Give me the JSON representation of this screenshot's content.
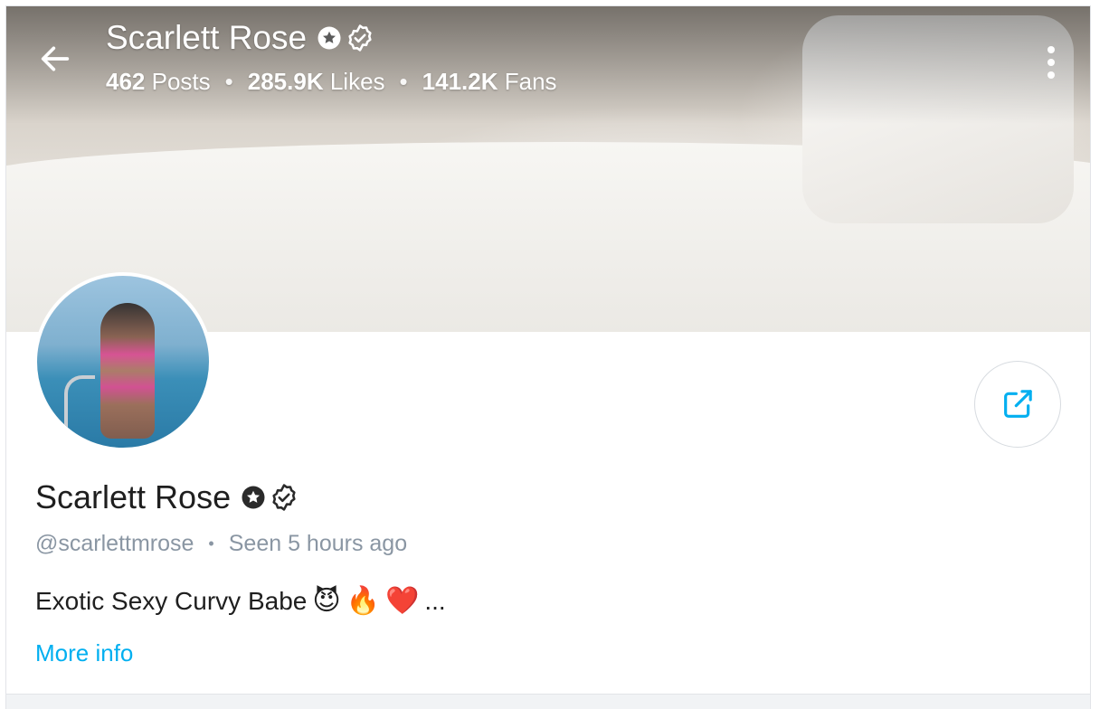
{
  "header": {
    "name": "Scarlett Rose",
    "stats": [
      {
        "value": "462",
        "label": "Posts"
      },
      {
        "value": "285.9K",
        "label": "Likes"
      },
      {
        "value": "141.2K",
        "label": "Fans"
      }
    ],
    "separator": "•",
    "text_color": "#ffffff"
  },
  "icons": {
    "back": "arrow-left-icon",
    "more": "more-vertical-icon",
    "share": "share-icon",
    "star_badge": "star-badge-icon",
    "verified_badge": "verified-check-icon"
  },
  "profile": {
    "name": "Scarlett Rose",
    "handle": "@scarlettmrose",
    "separator": "•",
    "seen": "Seen 5 hours ago",
    "bio_text": "Exotic Sexy Curvy Babe",
    "bio_emojis": [
      "😈",
      "🔥",
      "❤️"
    ],
    "bio_ellipsis": "...",
    "more_info": "More info"
  },
  "colors": {
    "accent": "#00aff0",
    "muted_text": "#8a96a3",
    "primary_text": "#1f1f1f"
  }
}
